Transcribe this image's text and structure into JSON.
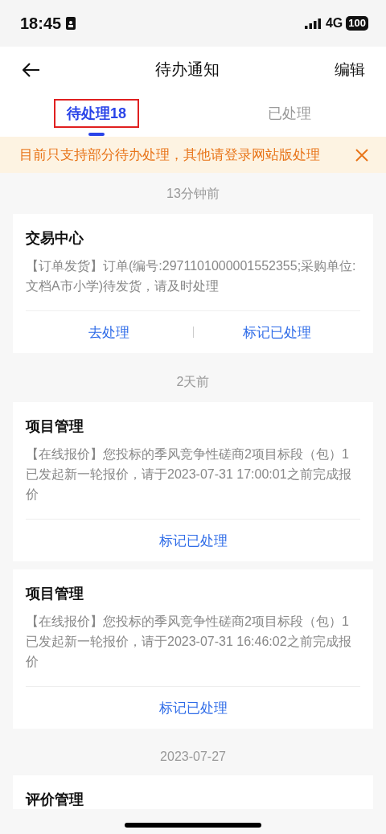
{
  "status_bar": {
    "time": "18:45",
    "network": "4G",
    "battery": "100"
  },
  "nav": {
    "title": "待办通知",
    "action": "编辑"
  },
  "tabs": [
    {
      "label": "待处理18",
      "selected": true,
      "highlighted": true
    },
    {
      "label": "已处理",
      "selected": false,
      "highlighted": false
    }
  ],
  "notice": {
    "text": "目前只支持部分待办处理，其他请登录网站版处理",
    "dismissible": true
  },
  "groups": [
    {
      "time": "13分钟前",
      "cards": [
        {
          "title": "交易中心",
          "body": "【订单发货】订单(编号:2971101000001552355;采购单位:文档A市小学)待发货，请及时处理",
          "actions": [
            "去处理",
            "标记已处理"
          ]
        }
      ]
    },
    {
      "time": "2天前",
      "cards": [
        {
          "title": "项目管理",
          "body": "【在线报价】您投标的季风竞争性磋商2项目标段（包）1已发起新一轮报价，请于2023-07-31 17:00:01之前完成报价",
          "actions": [
            "标记已处理"
          ]
        },
        {
          "title": "项目管理",
          "body": "【在线报价】您投标的季风竞争性磋商2项目标段（包）1已发起新一轮报价，请于2023-07-31 16:46:02之前完成报价",
          "actions": [
            "标记已处理"
          ]
        }
      ]
    },
    {
      "time": "2023-07-27",
      "cards": [
        {
          "title": "评价管理"
        }
      ]
    }
  ]
}
